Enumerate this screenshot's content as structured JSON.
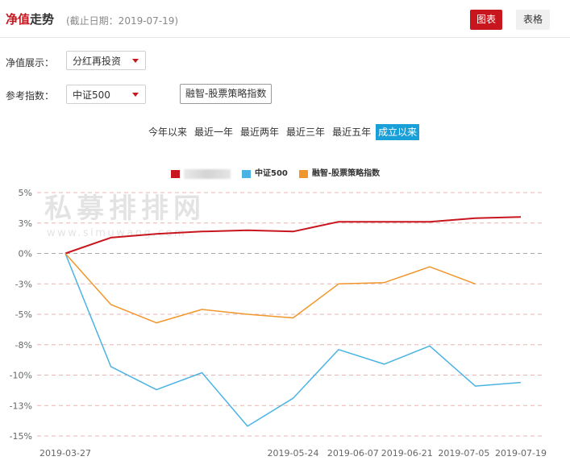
{
  "header": {
    "title_accent": "净值",
    "title_rest": "走势",
    "subtitle": "(截止日期：2019-07-19)",
    "chart_button": "图表",
    "table_button": "表格"
  },
  "controls": {
    "nav_display_label": "净值展示：",
    "nav_display_value": "分红再投资",
    "benchmark_label": "参考指数：",
    "benchmark_value": "中证500",
    "strategy_index_button": "融智-股票策略指数"
  },
  "periods": [
    {
      "label": "今年以来",
      "active": false
    },
    {
      "label": "最近一年",
      "active": false
    },
    {
      "label": "最近两年",
      "active": false
    },
    {
      "label": "最近三年",
      "active": false
    },
    {
      "label": "最近五年",
      "active": false
    },
    {
      "label": "成立以来",
      "active": true
    }
  ],
  "watermark": {
    "cn": "私募排排网",
    "en": "www.simuwang.com"
  },
  "colors": {
    "accent": "#c8161e",
    "fund": "#c8161e",
    "csi500": "#4ab3e3",
    "strategy": "#f0962a",
    "active_tab": "#1aa0d9"
  },
  "chart_data": {
    "type": "line",
    "x": [
      "2019-03-27",
      "2019-04-04",
      "2019-04-12",
      "2019-04-18",
      "2019-04-26",
      "2019-05-06",
      "2019-05-10",
      "2019-05-17",
      "2019-05-24",
      "2019-05-31",
      "2019-06-06",
      "2019-06-14",
      "2019-06-21",
      "2019-06-28",
      "2019-07-05",
      "2019-07-12",
      "2019-07-19"
    ],
    "x_tick_labels": [
      "2019-03-27",
      "2019-05-24",
      "2019-06-07",
      "2019-06-21",
      "2019-07-05",
      "2019-07-19"
    ],
    "y_tick_labels": [
      "5%",
      "3%",
      "0%",
      "-3%",
      "-5%",
      "-8%",
      "-10%",
      "-13%",
      "-15%"
    ],
    "ylim": [
      -15,
      5
    ],
    "grid": true,
    "legend_position": "top",
    "series": [
      {
        "name": "",
        "legend_obscured": true,
        "color": "#c8161e",
        "values": [
          0.0,
          1.3,
          1.6,
          1.8,
          1.9,
          1.8,
          2.6,
          2.6,
          2.6,
          2.9,
          3.0
        ]
      },
      {
        "name": "中证500",
        "color": "#4ab3e3",
        "values": [
          0.0,
          -9.3,
          -11.2,
          -9.8,
          -14.2,
          -11.9,
          -7.9,
          -9.1,
          -7.6,
          -10.9,
          -10.6
        ]
      },
      {
        "name": "融智-股票策略指数",
        "color": "#f0962a",
        "values": [
          0.0,
          -4.2,
          -5.7,
          -4.6,
          -5.0,
          -5.3,
          -2.5,
          -2.4,
          -1.1,
          -2.5
        ]
      }
    ]
  }
}
